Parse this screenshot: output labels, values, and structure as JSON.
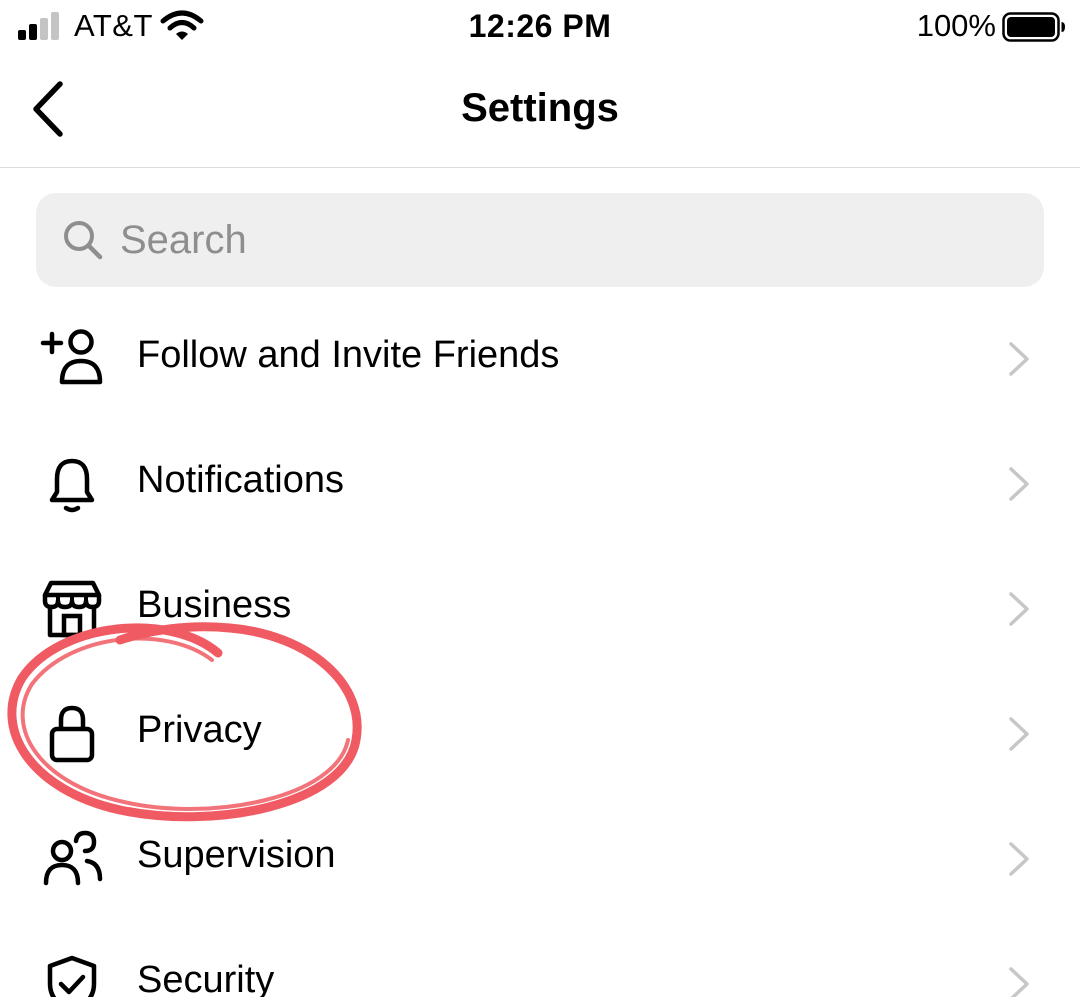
{
  "status_bar": {
    "carrier": "AT&T",
    "time": "12:26 PM",
    "battery_percent": "100%",
    "signal_bars_filled": 2,
    "signal_bars_total": 4
  },
  "header": {
    "title": "Settings",
    "back_icon": "chevron-left-icon"
  },
  "search": {
    "placeholder": "Search",
    "value": "",
    "icon": "search-icon"
  },
  "menu": {
    "items": [
      {
        "label": "Follow and Invite Friends",
        "icon": "add-person-icon"
      },
      {
        "label": "Notifications",
        "icon": "bell-icon"
      },
      {
        "label": "Business",
        "icon": "storefront-icon"
      },
      {
        "label": "Privacy",
        "icon": "lock-icon"
      },
      {
        "label": "Supervision",
        "icon": "people-icon"
      },
      {
        "label": "Security",
        "icon": "shield-check-icon"
      }
    ]
  },
  "annotation": {
    "highlighted_item": "Privacy",
    "color": "#f05a62"
  },
  "colors": {
    "search_bg": "#efefef",
    "placeholder": "#8e8e8e",
    "chevron": "#c7c7c7",
    "divider": "#dbdbdb"
  }
}
